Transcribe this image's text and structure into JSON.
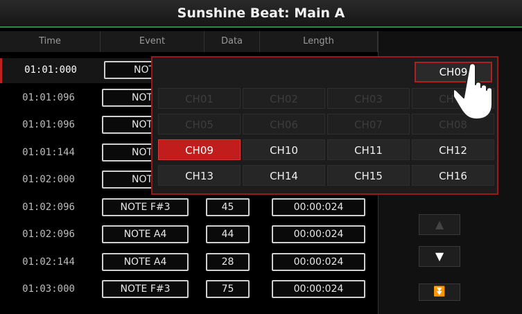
{
  "title": "Sunshine Beat: Main A",
  "columns": [
    "Time",
    "Event",
    "Data",
    "Length"
  ],
  "rows": [
    {
      "time": "01:01:000",
      "event": "NOTE",
      "data": "",
      "length": ""
    },
    {
      "time": "01:01:096",
      "event": "NOTE",
      "data": "",
      "length": ""
    },
    {
      "time": "01:01:096",
      "event": "NOTE",
      "data": "",
      "length": ""
    },
    {
      "time": "01:01:144",
      "event": "NOTE",
      "data": "",
      "length": ""
    },
    {
      "time": "01:02:000",
      "event": "NOTE",
      "data": "",
      "length": ""
    },
    {
      "time": "01:02:096",
      "event": "NOTE F#3",
      "data": "45",
      "length": "00:00:024"
    },
    {
      "time": "01:02:096",
      "event": "NOTE A4",
      "data": "44",
      "length": "00:00:024"
    },
    {
      "time": "01:02:144",
      "event": "NOTE A4",
      "data": "28",
      "length": "00:00:024"
    },
    {
      "time": "01:03:000",
      "event": "NOTE F#3",
      "data": "75",
      "length": "00:00:024"
    }
  ],
  "nav": {
    "up": "▲",
    "down": "▼",
    "bottom": "⏬"
  },
  "popup": {
    "current": "CH09",
    "channels": [
      "CH01",
      "CH02",
      "CH03",
      "CH04",
      "CH05",
      "CH06",
      "CH07",
      "CH08",
      "CH09",
      "CH10",
      "CH11",
      "CH12",
      "CH13",
      "CH14",
      "CH15",
      "CH16"
    ],
    "selected": "CH09"
  },
  "colors": {
    "accent": "#c21d1d",
    "title_line": "#2f8a3a"
  },
  "icons": {
    "hand": "pointing-hand-icon"
  }
}
